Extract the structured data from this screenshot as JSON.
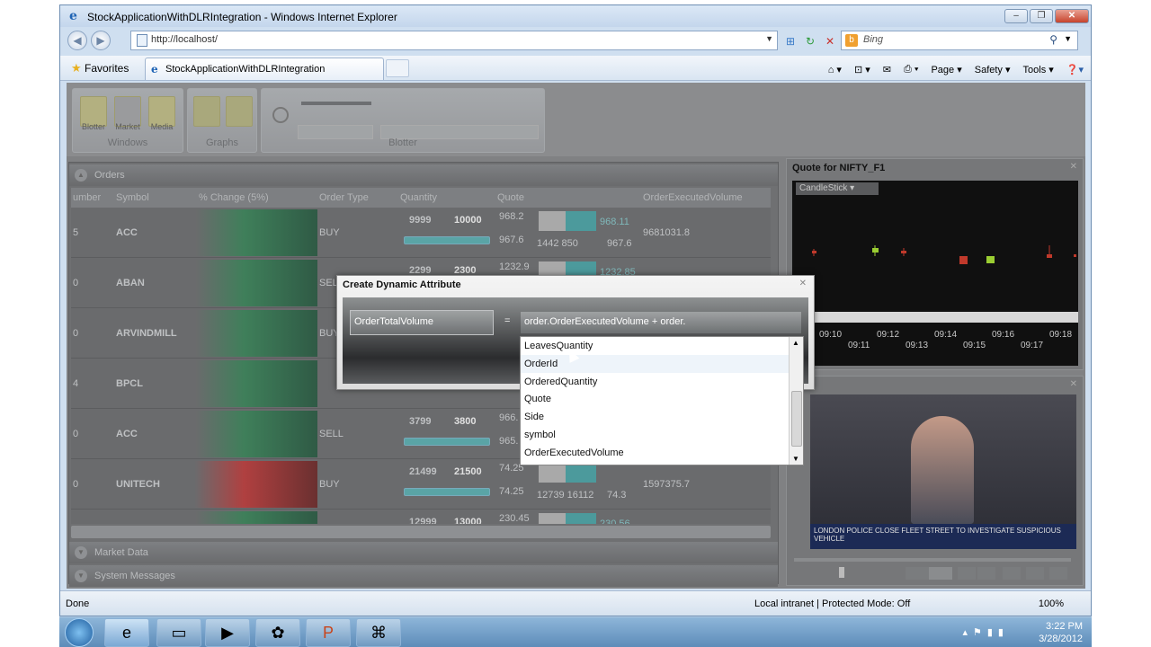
{
  "window": {
    "title": "StockApplicationWithDLRIntegration - Windows Internet Explorer"
  },
  "address": {
    "url": "http://localhost/"
  },
  "search": {
    "placeholder": "Bing"
  },
  "favorites": {
    "label": "Favorites"
  },
  "tab": {
    "label": "StockApplicationWithDLRIntegration"
  },
  "commandbar": {
    "page": "Page ▾",
    "safety": "Safety ▾",
    "tools": "Tools ▾"
  },
  "ribbon": {
    "windows": {
      "label": "Windows",
      "items": [
        "Blotter",
        "Market",
        "Media"
      ]
    },
    "graphs": {
      "label": "Graphs"
    },
    "blotter": {
      "label": "Blotter"
    }
  },
  "orders": {
    "title": "Orders",
    "columns": [
      "umber",
      "Symbol",
      "% Change (5%)",
      "Order Type",
      "Quantity",
      "Quote",
      "OrderExecutedVolume"
    ],
    "rows": [
      {
        "num": "5",
        "symbol": "ACC",
        "type": "BUY",
        "q1": "9999",
        "q2": "10000",
        "quote_hi": "968.2",
        "quote_lo": "967.6",
        "quote_mid": "1442 850",
        "quote_a": "968.11",
        "quote_b": "967.6",
        "volume": "9681031.8",
        "fill": 1.0
      },
      {
        "num": "0",
        "symbol": "ABAN",
        "type": "SELL",
        "q1": "2299",
        "q2": "2300",
        "quote_hi": "1232.9",
        "quote_lo": "",
        "quote_mid": "",
        "quote_a": "1232.85",
        "quote_b": "",
        "volume": "",
        "fill": 1.0
      },
      {
        "num": "0",
        "symbol": "ARVINDMILL",
        "type": "BUY",
        "q1": "",
        "q2": "",
        "quote_hi": "",
        "quote_lo": "",
        "quote_mid": "",
        "quote_a": "",
        "quote_b": "",
        "volume": "",
        "fill": 0
      },
      {
        "num": "4",
        "symbol": "BPCL",
        "type": "",
        "q1": "",
        "q2": "",
        "quote_hi": "",
        "quote_lo": "",
        "quote_mid": "",
        "quote_a": "",
        "quote_b": "",
        "volume": "",
        "fill": 0
      },
      {
        "num": "0",
        "symbol": "ACC",
        "type": "SELL",
        "q1": "3799",
        "q2": "3800",
        "quote_hi": "966.",
        "quote_lo": "965.",
        "quote_mid": "",
        "quote_a": "",
        "quote_b": "",
        "volume": "",
        "fill": 1.0
      },
      {
        "num": "0",
        "symbol": "UNITECH",
        "type": "BUY",
        "q1": "21499",
        "q2": "21500",
        "quote_hi": "74.25",
        "quote_lo": "74.25",
        "quote_mid": "12739 16112",
        "quote_a": "",
        "quote_b": "74.3",
        "volume": "1597375.7",
        "fill": 1.0
      },
      {
        "num": "",
        "symbol": "",
        "type": "",
        "q1": "12999",
        "q2": "13000",
        "quote_hi": "230.45",
        "quote_lo": "",
        "quote_mid": "",
        "quote_a": "230.56",
        "quote_b": "",
        "volume": "",
        "fill": 0
      }
    ]
  },
  "sections": {
    "market_data": "Market Data",
    "system_messages": "System Messages"
  },
  "quote_panel": {
    "title": "Quote for NIFTY_F1",
    "chart_type": "CandleStick",
    "times_top": [
      "09:10",
      "09:12",
      "09:14",
      "09:16",
      "09:18"
    ],
    "times_bottom": [
      "09:11",
      "09:13",
      "09:15",
      "09:17"
    ]
  },
  "video": {
    "ticker": "LONDON POLICE CLOSE FLEET STREET TO INVESTIGATE SUSPICIOUS VEHICLE"
  },
  "dialog": {
    "title": "Create Dynamic Attribute",
    "name_value": "OrderTotalVolume",
    "equals": "=",
    "expression_value": "order.OrderExecutedVolume + order."
  },
  "autocomplete": {
    "items": [
      "LeavesQuantity",
      "OrderId",
      "OrderedQuantity",
      "Quote",
      "Side",
      "symbol",
      "OrderExecutedVolume"
    ],
    "highlighted_index": 1
  },
  "status": {
    "left": "Done",
    "zone": "Local intranet | Protected Mode: Off",
    "zoom": "100%"
  },
  "taskbar": {
    "time": "3:22 PM",
    "date": "3/28/2012"
  }
}
